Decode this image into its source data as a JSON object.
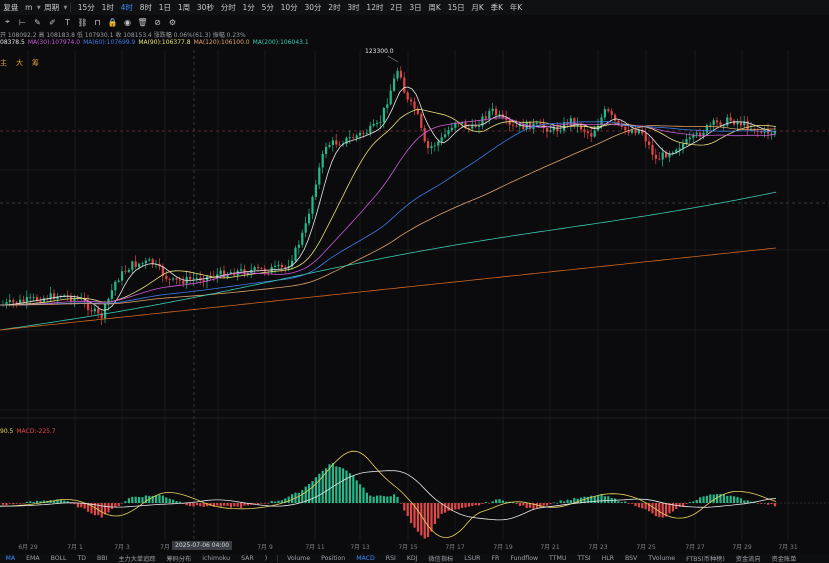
{
  "toolbar": {
    "items": [
      {
        "label": "复盘",
        "caret": false,
        "active": false
      },
      {
        "label": "m",
        "caret": true,
        "active": false
      },
      {
        "label": "周期",
        "caret": true,
        "active": false
      },
      {
        "label": "15分",
        "caret": false,
        "active": false
      },
      {
        "label": "1时",
        "caret": false,
        "active": false
      },
      {
        "label": "4时",
        "caret": false,
        "active": true
      },
      {
        "label": "8时",
        "caret": false,
        "active": false
      },
      {
        "label": "1日",
        "caret": false,
        "active": false
      },
      {
        "label": "1周",
        "caret": false,
        "active": false
      },
      {
        "label": "30秒",
        "caret": false,
        "active": false
      },
      {
        "label": "分时",
        "caret": false,
        "active": false
      },
      {
        "label": "1分",
        "caret": false,
        "active": false
      },
      {
        "label": "5分",
        "caret": false,
        "active": false
      },
      {
        "label": "10分",
        "caret": false,
        "active": false
      },
      {
        "label": "30分",
        "caret": false,
        "active": false
      },
      {
        "label": "2时",
        "caret": false,
        "active": false
      },
      {
        "label": "3时",
        "caret": false,
        "active": false
      },
      {
        "label": "12时",
        "caret": false,
        "active": false
      },
      {
        "label": "2日",
        "caret": false,
        "active": false
      },
      {
        "label": "3日",
        "caret": false,
        "active": false
      },
      {
        "label": "周K",
        "caret": false,
        "active": false
      },
      {
        "label": "15日",
        "caret": false,
        "active": false
      },
      {
        "label": "月K",
        "caret": false,
        "active": false
      },
      {
        "label": "季K",
        "caret": false,
        "active": false
      },
      {
        "label": "年K",
        "caret": false,
        "active": false
      }
    ]
  },
  "tool_icons": [
    "crosshair-icon",
    "ruler-icon",
    "pencil-icon",
    "brush-icon",
    "text-icon",
    "link-icon",
    "magnet-icon",
    "lock-icon",
    "eye-icon",
    "trash-icon",
    "hide-icon",
    "settings-icon"
  ],
  "tool_glyphs": [
    "⌖",
    "⊢",
    "✎",
    "✐",
    "Ｔ",
    "⛓",
    "⊓",
    "🔒",
    "◉",
    "🗑",
    "⊘",
    "⚙"
  ],
  "ohlc_text": "开 108092.2  高 108183.8  低 107930.1  收 108153.4  涨跌幅 0.06%(61.3)  振幅 0.23%",
  "ma_lines": [
    {
      "label": "08378.5",
      "color": "#e8e8e8"
    },
    {
      "label": "MA(30):107974.0",
      "color": "#c85bd6"
    },
    {
      "label": "MA(60):107699.9",
      "color": "#3d7be8"
    },
    {
      "label": "MA(90):106377.8",
      "color": "#e8e07a"
    },
    {
      "label": "MA(120):106100.0",
      "color": "#e0a36a"
    },
    {
      "label": "MA(200):106043.1",
      "color": "#3ac8b0"
    }
  ],
  "side_letters": [
    "主",
    "大",
    "筹"
  ],
  "peak_label": "123300.0",
  "macd_info": [
    {
      "label": "90.5",
      "color": "#e8d35a"
    },
    {
      "label": "MACD:-225.7",
      "color": "#e84a4a"
    }
  ],
  "crosshair_date": "2025-07-06 04:00",
  "x_labels": [
    "6月 29",
    "7月 1",
    "7月 3",
    "7月",
    "7月 9",
    "7月 11",
    "7月 13",
    "7月 15",
    "7月 17",
    "7月 19",
    "7月 21",
    "7月 23",
    "7月 25",
    "7月 27",
    "7月 29",
    "7月 31"
  ],
  "bottom_tabs": [
    {
      "label": "MA",
      "active": true
    },
    {
      "label": "EMA",
      "active": false
    },
    {
      "label": "BOLL",
      "active": false
    },
    {
      "label": "TD",
      "active": false
    },
    {
      "label": "BBI",
      "active": false
    },
    {
      "label": "主力大单追踪",
      "active": false
    },
    {
      "label": "筹码分布",
      "active": false
    },
    {
      "label": "ichimoku",
      "active": false
    },
    {
      "label": "SAR",
      "active": false
    },
    {
      "label": ")",
      "active": false
    },
    {
      "label": "Volume",
      "active": false
    },
    {
      "label": "Position",
      "active": false
    },
    {
      "label": "MACD",
      "active": true
    },
    {
      "label": "RSI",
      "active": false
    },
    {
      "label": "KDJ",
      "active": false
    },
    {
      "label": "微信指标",
      "active": false
    },
    {
      "label": "LSUR",
      "active": false
    },
    {
      "label": "FR",
      "active": false
    },
    {
      "label": "Fundflow",
      "active": false
    },
    {
      "label": "TTMU",
      "active": false
    },
    {
      "label": "TTSI",
      "active": false
    },
    {
      "label": "HLR",
      "active": false
    },
    {
      "label": "BSV",
      "active": false
    },
    {
      "label": "TVolume",
      "active": false
    },
    {
      "label": "FTBS(币种榜)",
      "active": false
    },
    {
      "label": "资金流向",
      "active": false
    },
    {
      "label": "资金账单",
      "active": false
    }
  ],
  "colors": {
    "up": "#26b88a",
    "down": "#e04848",
    "ma30": "#c85bd6",
    "ma60": "#3d7be8",
    "ma90": "#e8e07a",
    "ma120": "#e0a36a",
    "ma200": "#3ac8b0",
    "dif": "#e8d35a",
    "dea": "#e8e8e8"
  }
}
